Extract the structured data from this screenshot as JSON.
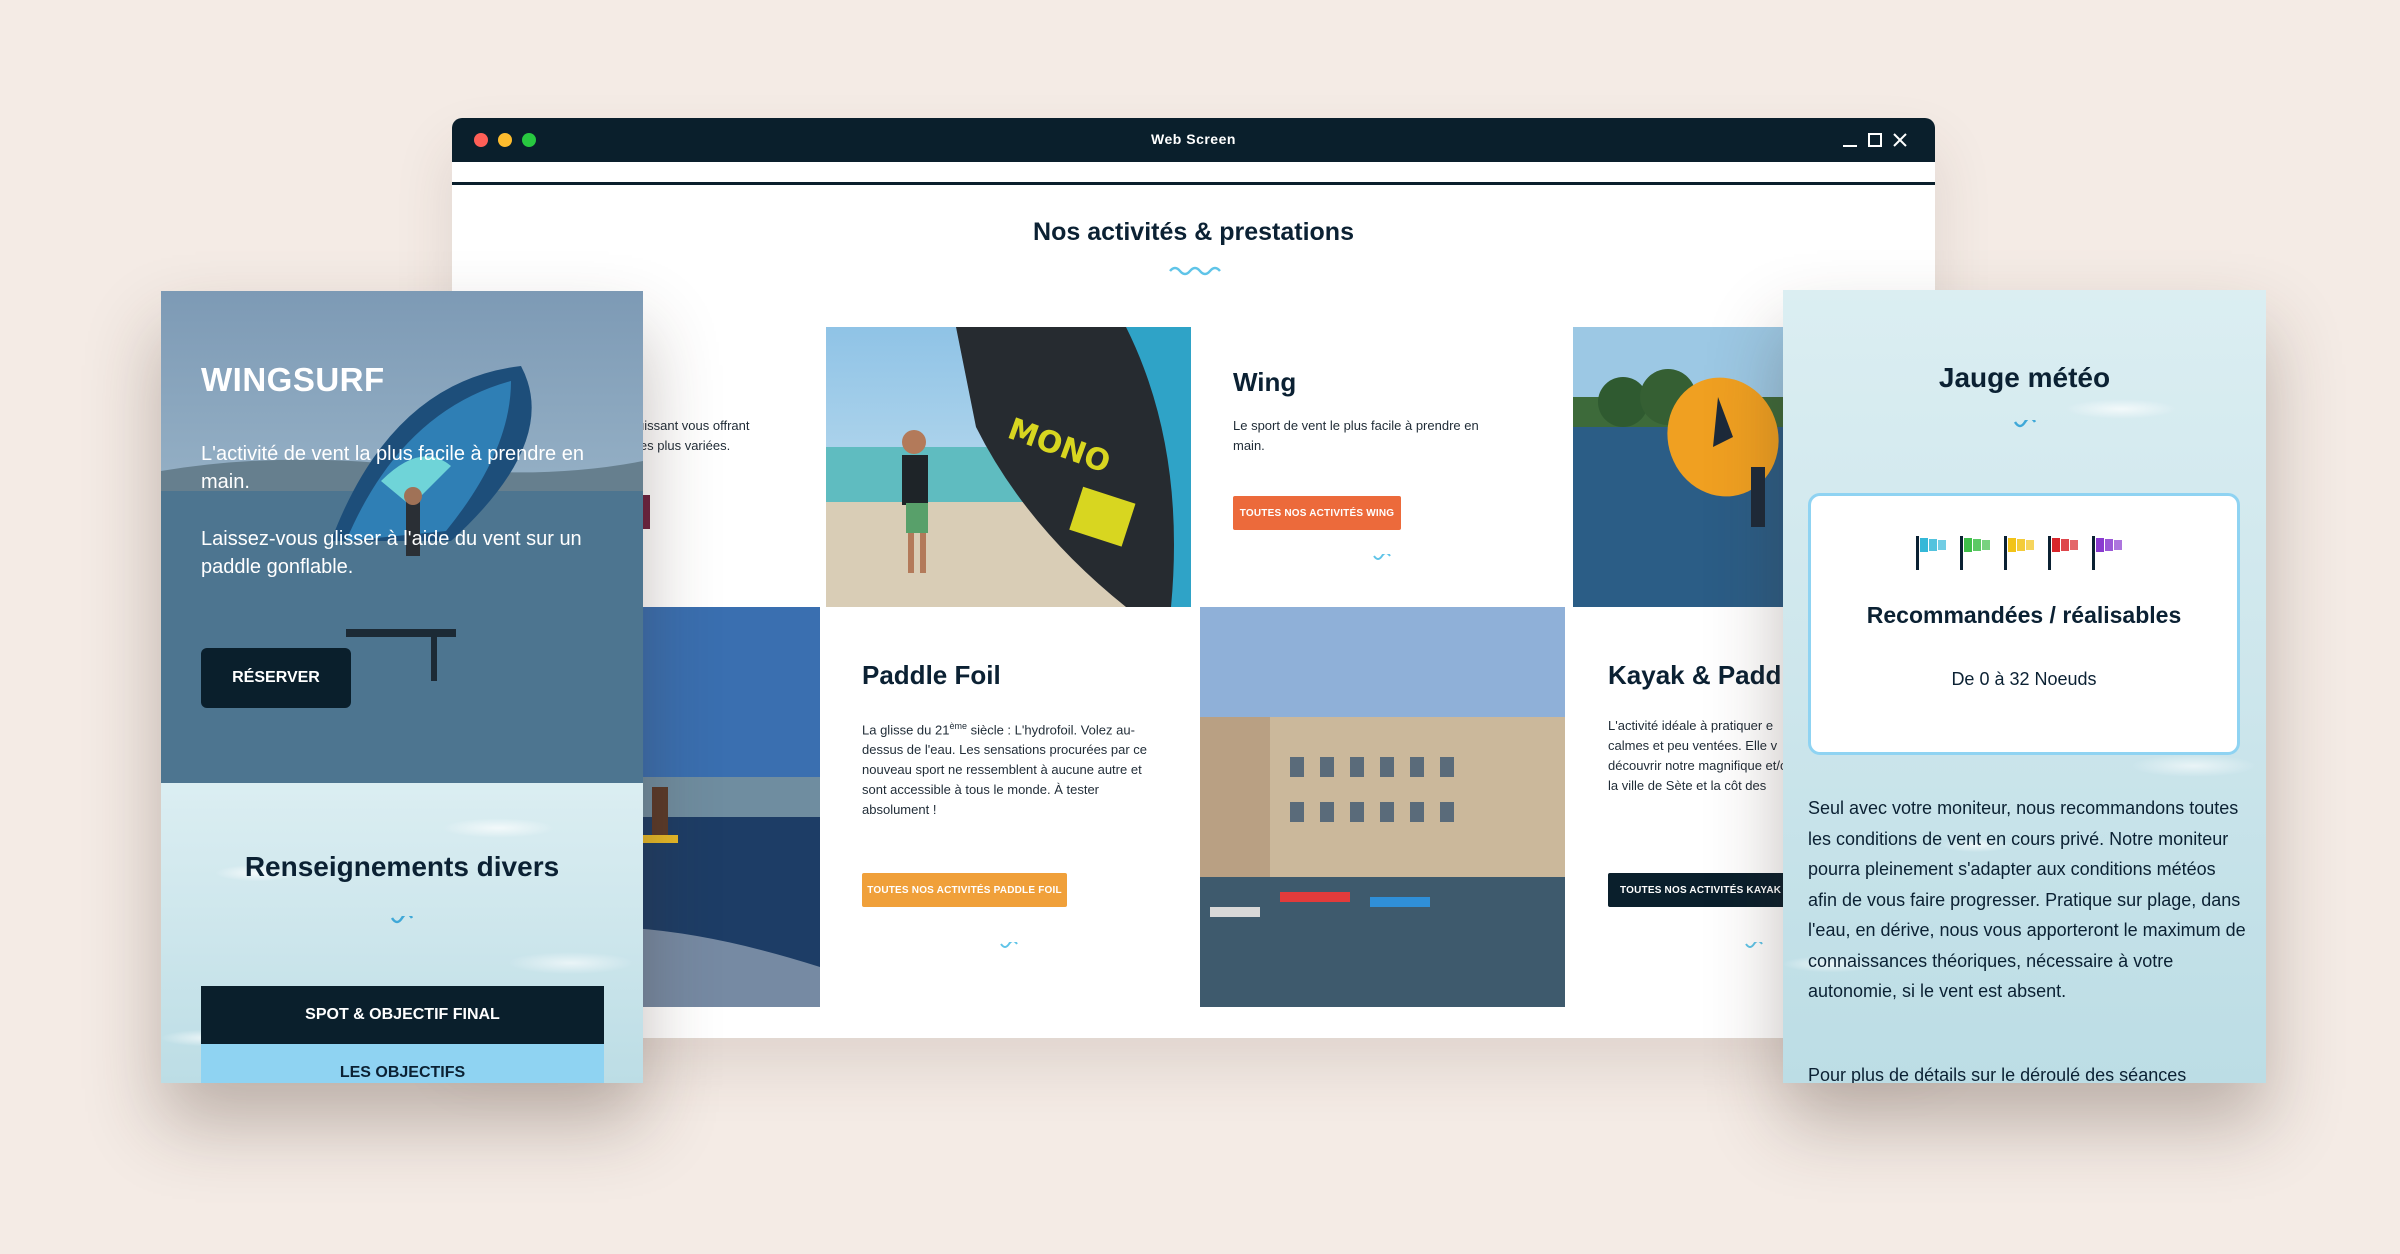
{
  "window": {
    "title": "Web Screen"
  },
  "section": {
    "title": "Nos activités & prestations"
  },
  "cards": {
    "kite": {
      "text_line1": "uissant vous offrant",
      "text_line2": "les plus variées."
    },
    "wing": {
      "title": "Wing",
      "text": "Le sport de vent le plus facile à prendre en main.",
      "button": "TOUTES NOS ACTIVITÉS WING",
      "button_color": "#ec6a3b"
    },
    "paddle_foil": {
      "title": "Paddle Foil",
      "text_before_sup": "La glisse du 21",
      "text_sup": "ème",
      "text_after_sup": " siècle : L'hydrofoil. Volez au-dessus de l'eau. Les sensations procurées par ce nouveau sport ne ressemblent à aucune autre et sont accessible à tous le monde. À tester absolument !",
      "button": "TOUTES NOS ACTIVITÉS PADDLE FOIL",
      "button_color": "#f0a03a"
    },
    "kayak": {
      "title": "Kayak & Paddle",
      "text": "L'activité idéale à pratiquer e calmes et peu ventées. Elle v découvrir notre magnifique et/ou la ville de Sète et la côt des guides.",
      "button": "TOUTES NOS ACTIVITÉS KAYAK & P",
      "button_color": "#0a1f2c"
    }
  },
  "mobile_left": {
    "hero_title": "WINGSURF",
    "hero_text_1": "L'activité de vent la plus facile à prendre en main.",
    "hero_text_2": "Laissez-vous glisser à l'aide du vent sur un paddle gonflable.",
    "reserve_button": "RÉSERVER",
    "renseignements_title": "Renseignements divers",
    "accordion": [
      "SPOT & OBJECTIF FINAL",
      "LES OBJECTIFS"
    ]
  },
  "mobile_right": {
    "title": "Jauge météo",
    "recommendation": "Recommandées / réalisables",
    "wind_range": "De 0 à 32 Noeuds",
    "flag_colors": [
      "#35b8d8",
      "#3fbf4a",
      "#f2c318",
      "#d8262b",
      "#8a3bd0"
    ],
    "paragraph_1": "Seul avec votre moniteur, nous recommandons toutes les conditions de vent en cours privé. Notre moniteur pourra pleinement s'adapter aux conditions météos afin de vous faire progresser. Pratique sur plage, dans l'eau, en dérive, nous vous apporteront le maximum de connaissances théoriques, nécessaire à votre autonomie, si le vent est absent.",
    "paragraph_2": "Pour plus de détails sur le déroulé des séances"
  }
}
